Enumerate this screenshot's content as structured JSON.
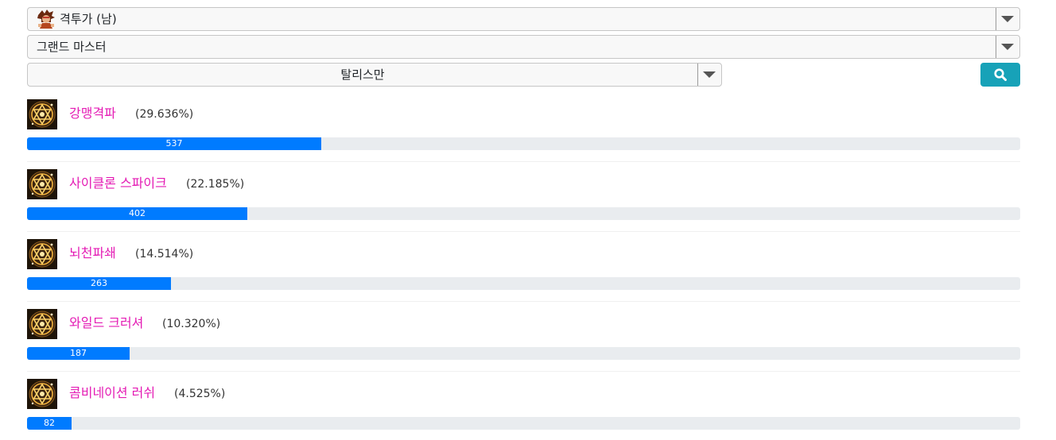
{
  "filters": {
    "character": "격투가 (남)",
    "character_icon": "fighter-male-avatar-icon",
    "advancement": "그랜드 마스터",
    "item_type": "탈리스만"
  },
  "search_button": {
    "icon": "search-icon",
    "color": "#17a2b8"
  },
  "colors": {
    "skill_name": "#e41bb4",
    "bar_fill": "#007bff",
    "bar_track": "#e9ecef"
  },
  "skills": [
    {
      "name": "강맹격파",
      "percent": "(29.636%)",
      "count": "537",
      "fraction": 0.29636,
      "icon": "talisman-star-icon"
    },
    {
      "name": "사이클론 스파이크",
      "percent": "(22.185%)",
      "count": "402",
      "fraction": 0.22185,
      "icon": "talisman-star-icon"
    },
    {
      "name": "뇌천파쇄",
      "percent": "(14.514%)",
      "count": "263",
      "fraction": 0.14514,
      "icon": "talisman-star-icon"
    },
    {
      "name": "와일드 크러셔",
      "percent": "(10.320%)",
      "count": "187",
      "fraction": 0.1032,
      "icon": "talisman-star-icon"
    },
    {
      "name": "콤비네이션 러쉬",
      "percent": "(4.525%)",
      "count": "82",
      "fraction": 0.04525,
      "icon": "talisman-star-icon"
    }
  ]
}
